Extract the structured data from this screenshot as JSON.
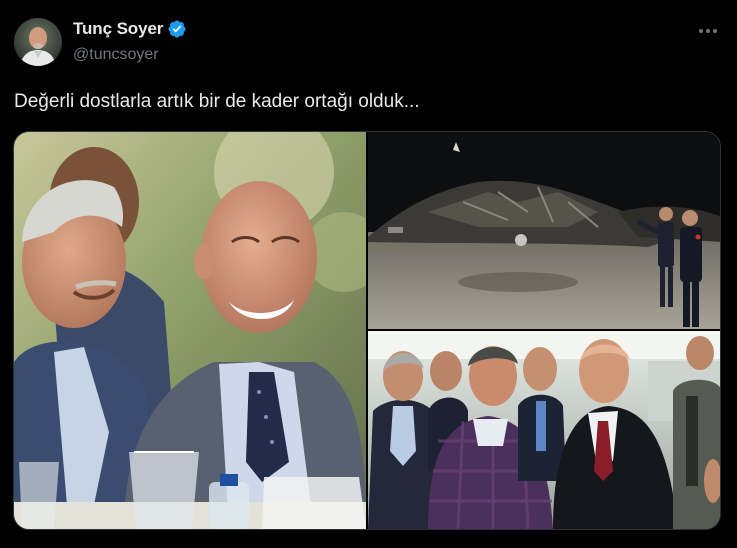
{
  "author": {
    "display_name": "Tunç Soyer",
    "handle": "@tuncsoyer",
    "verified": true,
    "verified_icon": "verified-badge-icon",
    "verified_color": "#1d9bf0"
  },
  "menu": {
    "icon": "more-dots-icon"
  },
  "tweet": {
    "text": "Değerli dostlarla artık bir de kader ortağı olduk..."
  },
  "media": {
    "count": 3,
    "photos": [
      {
        "id": "photo-1"
      },
      {
        "id": "photo-2"
      },
      {
        "id": "photo-3"
      }
    ]
  },
  "colors": {
    "background": "#000000",
    "text_primary": "#e7e9ea",
    "text_secondary": "#71767b",
    "border": "#2f3336"
  }
}
